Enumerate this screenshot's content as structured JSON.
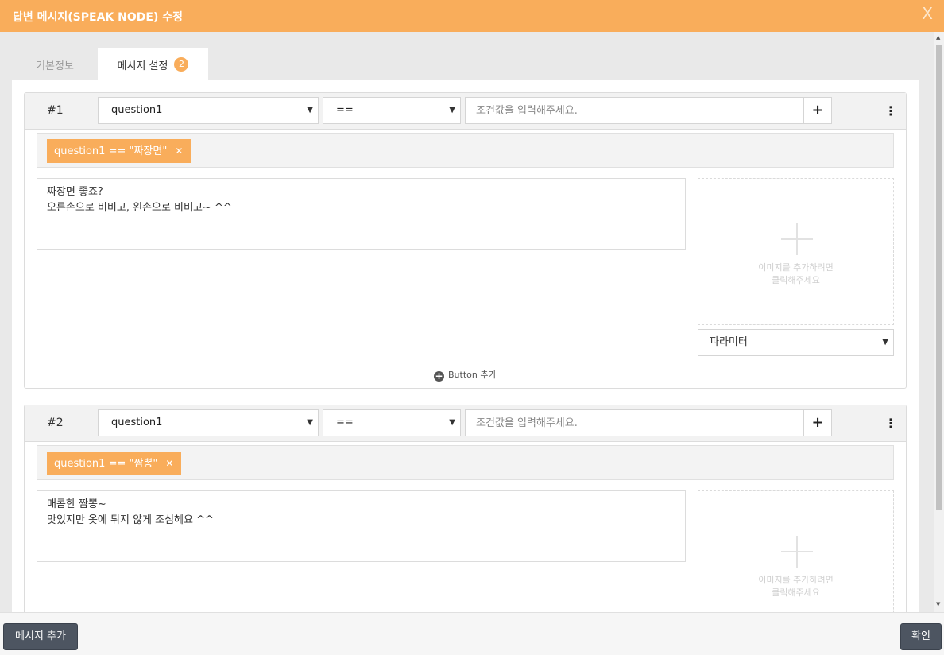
{
  "dialog": {
    "title": "답변 메시지(SPEAK NODE) 수정",
    "close_glyph": "X"
  },
  "tabs": [
    {
      "label": "기본정보"
    },
    {
      "label": "메시지 설정",
      "badge": "2"
    }
  ],
  "cards": [
    {
      "number": "#1",
      "variable": "question1",
      "operator": "==",
      "condition_placeholder": "조건값을 입력해주세요.",
      "condition_value": "",
      "tag": "question1 == \"짜장면\"",
      "message": "짜장면 좋죠?\n오른손으로 비비고, 왼손으로 비비고~ ^^",
      "image_hint": "이미지를 추가하려면\n클릭해주세요",
      "parameter": "파라미터",
      "button_add": "Button 추가"
    },
    {
      "number": "#2",
      "variable": "question1",
      "operator": "==",
      "condition_placeholder": "조건값을 입력해주세요.",
      "condition_value": "",
      "tag": "question1 == \"짬뽕\"",
      "message": "매콤한 짬뽕~\n맛있지만 옷에 튀지 않게 조심헤요 ^^",
      "image_hint": "이미지를 추가하려면\n클릭해주세요"
    }
  ],
  "footer": {
    "add_message": "메시지 추가",
    "confirm": "확인"
  },
  "colors": {
    "accent": "#f9ad5b",
    "dark_button": "#4d5561"
  }
}
